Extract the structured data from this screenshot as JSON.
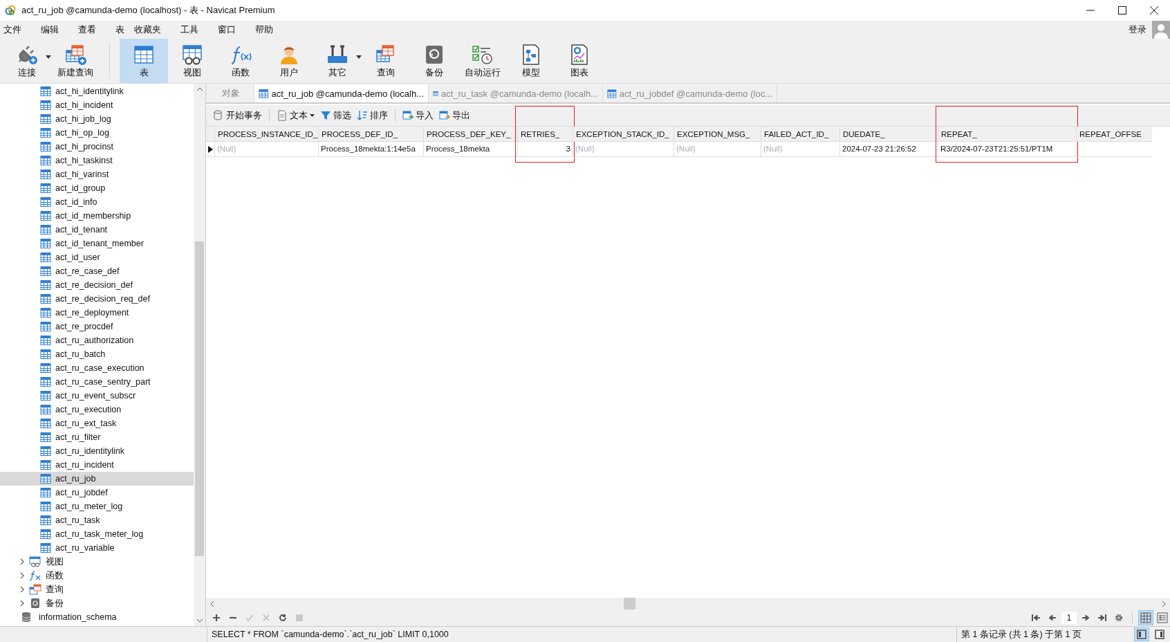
{
  "window": {
    "title": "act_ru_job @camunda-demo (localhost) - 表 - Navicat Premium"
  },
  "menu": [
    "文件",
    "编辑",
    "查看",
    "表",
    "收藏夹",
    "工具",
    "窗口",
    "帮助"
  ],
  "login": {
    "label": "登录"
  },
  "toolbar": [
    {
      "label": "连接",
      "kind": "connect",
      "selected": false,
      "dropdown": true
    },
    {
      "label": "新建查询",
      "kind": "newquery",
      "selected": false,
      "dropdown": false
    },
    {
      "label": "表",
      "kind": "table",
      "selected": true,
      "dropdown": false
    },
    {
      "label": "视图",
      "kind": "view",
      "selected": false,
      "dropdown": false
    },
    {
      "label": "函数",
      "kind": "function",
      "selected": false,
      "dropdown": false
    },
    {
      "label": "用户",
      "kind": "user",
      "selected": false,
      "dropdown": false
    },
    {
      "label": "其它",
      "kind": "tools",
      "selected": false,
      "dropdown": true
    },
    {
      "label": "查询",
      "kind": "query",
      "selected": false,
      "dropdown": false
    },
    {
      "label": "备份",
      "kind": "backup",
      "selected": false,
      "dropdown": false
    },
    {
      "label": "自动运行",
      "kind": "schedule",
      "selected": false,
      "dropdown": false
    },
    {
      "label": "模型",
      "kind": "model",
      "selected": false,
      "dropdown": false
    },
    {
      "label": "图表",
      "kind": "chart",
      "selected": false,
      "dropdown": false
    }
  ],
  "sidebar": {
    "tables": [
      {
        "label": "act_hi_identitylink",
        "selected": false
      },
      {
        "label": "act_hi_incident",
        "selected": false
      },
      {
        "label": "act_hi_job_log",
        "selected": false
      },
      {
        "label": "act_hi_op_log",
        "selected": false
      },
      {
        "label": "act_hi_procinst",
        "selected": false
      },
      {
        "label": "act_hi_taskinst",
        "selected": false
      },
      {
        "label": "act_hi_varinst",
        "selected": false
      },
      {
        "label": "act_id_group",
        "selected": false
      },
      {
        "label": "act_id_info",
        "selected": false
      },
      {
        "label": "act_id_membership",
        "selected": false
      },
      {
        "label": "act_id_tenant",
        "selected": false
      },
      {
        "label": "act_id_tenant_member",
        "selected": false
      },
      {
        "label": "act_id_user",
        "selected": false
      },
      {
        "label": "act_re_case_def",
        "selected": false
      },
      {
        "label": "act_re_decision_def",
        "selected": false
      },
      {
        "label": "act_re_decision_req_def",
        "selected": false
      },
      {
        "label": "act_re_deployment",
        "selected": false
      },
      {
        "label": "act_re_procdef",
        "selected": false
      },
      {
        "label": "act_ru_authorization",
        "selected": false
      },
      {
        "label": "act_ru_batch",
        "selected": false
      },
      {
        "label": "act_ru_case_execution",
        "selected": false
      },
      {
        "label": "act_ru_case_sentry_part",
        "selected": false
      },
      {
        "label": "act_ru_event_subscr",
        "selected": false
      },
      {
        "label": "act_ru_execution",
        "selected": false
      },
      {
        "label": "act_ru_ext_task",
        "selected": false
      },
      {
        "label": "act_ru_filter",
        "selected": false
      },
      {
        "label": "act_ru_identitylink",
        "selected": false
      },
      {
        "label": "act_ru_incident",
        "selected": false
      },
      {
        "label": "act_ru_job",
        "selected": true
      },
      {
        "label": "act_ru_jobdef",
        "selected": false
      },
      {
        "label": "act_ru_meter_log",
        "selected": false
      },
      {
        "label": "act_ru_task",
        "selected": false
      },
      {
        "label": "act_ru_task_meter_log",
        "selected": false
      },
      {
        "label": "act_ru_variable",
        "selected": false
      }
    ],
    "groups": [
      {
        "label": "视图",
        "kind": "view",
        "expanded": false
      },
      {
        "label": "函数",
        "kind": "function",
        "expanded": false
      },
      {
        "label": "查询",
        "kind": "query",
        "expanded": false
      },
      {
        "label": "备份",
        "kind": "backup",
        "expanded": false
      }
    ],
    "databases": [
      {
        "label": "information_schema"
      }
    ]
  },
  "tabs": [
    {
      "label": "对象",
      "kind": "object",
      "selected": false
    },
    {
      "label": "act_ru_job @camunda-demo (localh...",
      "kind": "table",
      "selected": true
    },
    {
      "label": "act_ru_task @camunda-demo (localh...",
      "kind": "table",
      "selected": false
    },
    {
      "label": "act_ru_jobdef @camunda-demo (loc...",
      "kind": "table",
      "selected": false
    }
  ],
  "table_toolbar": [
    {
      "label": "开始事务",
      "kind": "transaction",
      "dropdown": false
    },
    {
      "label": "文本",
      "kind": "text",
      "dropdown": true
    },
    {
      "label": "筛选",
      "kind": "filter",
      "dropdown": false
    },
    {
      "label": "排序",
      "kind": "sort",
      "dropdown": false
    },
    {
      "label": "导入",
      "kind": "import",
      "dropdown": false
    },
    {
      "label": "导出",
      "kind": "export",
      "dropdown": false
    }
  ],
  "table": {
    "columns": [
      {
        "label": "PROCESS_INSTANCE_ID_",
        "highlighted": false
      },
      {
        "label": "PROCESS_DEF_ID_",
        "highlighted": false
      },
      {
        "label": "PROCESS_DEF_KEY_",
        "highlighted": false
      },
      {
        "label": "RETRIES_",
        "highlighted": true
      },
      {
        "label": "EXCEPTION_STACK_ID_",
        "highlighted": false
      },
      {
        "label": "EXCEPTION_MSG_",
        "highlighted": false
      },
      {
        "label": "FAILED_ACT_ID_",
        "highlighted": false
      },
      {
        "label": "DUEDATE_",
        "highlighted": false
      },
      {
        "label": "REPEAT_",
        "highlighted": true
      },
      {
        "label": "REPEAT_OFFSE",
        "highlighted": false
      }
    ],
    "rows": [
      {
        "current": true,
        "cells": [
          {
            "text": "(Null)",
            "null": true,
            "numeric": false
          },
          {
            "text": "Process_18mekta:1:14e5a",
            "null": false,
            "numeric": false
          },
          {
            "text": "Process_18mekta",
            "null": false,
            "numeric": false
          },
          {
            "text": "3",
            "null": false,
            "numeric": true
          },
          {
            "text": "(Null)",
            "null": true,
            "numeric": false
          },
          {
            "text": "(Null)",
            "null": true,
            "numeric": false
          },
          {
            "text": "(Null)",
            "null": true,
            "numeric": false
          },
          {
            "text": "2024-07-23 21:26:52",
            "null": false,
            "numeric": false
          },
          {
            "text": "R3/2024-07-23T21:25:51/PT1M",
            "null": false,
            "numeric": false
          }
        ]
      }
    ]
  },
  "record_tools": [
    {
      "kind": "add",
      "disabled": false
    },
    {
      "kind": "delete",
      "disabled": false
    },
    {
      "kind": "apply",
      "disabled": true
    },
    {
      "kind": "cancel",
      "disabled": true
    },
    {
      "kind": "refresh",
      "disabled": false
    },
    {
      "kind": "stop",
      "disabled": true
    }
  ],
  "pager": {
    "page": "1"
  },
  "views": [
    {
      "kind": "grid",
      "selected": true
    },
    {
      "kind": "form",
      "selected": false
    }
  ],
  "status_bar": {
    "sql": "SELECT * FROM `camunda-demo`.`act_ru_job` LIMIT 0,1000",
    "records": "第 1 条记录 (共 1 条) 于第 1 页",
    "panels": [
      {
        "kind": "left",
        "selected": true
      },
      {
        "kind": "right",
        "selected": false
      }
    ]
  }
}
